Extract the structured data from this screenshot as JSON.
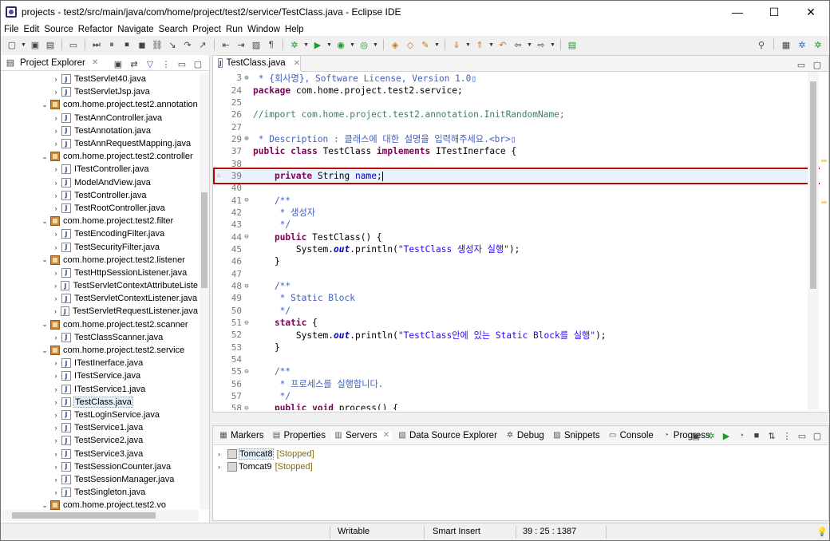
{
  "window": {
    "title": "projects - test2/src/main/java/com/home/project/test2/service/TestClass.java - Eclipse IDE",
    "minimize": "—",
    "maximize": "☐",
    "close": "✕"
  },
  "menu": [
    "File",
    "Edit",
    "Source",
    "Refactor",
    "Navigate",
    "Search",
    "Project",
    "Run",
    "Window",
    "Help"
  ],
  "project_explorer": {
    "title": "Project Explorer",
    "items": [
      {
        "label": "TestServlet40.java",
        "type": "java",
        "indent": 2,
        "twisty": "›"
      },
      {
        "label": "TestServletJsp.java",
        "type": "java",
        "indent": 2,
        "twisty": "›"
      },
      {
        "label": "com.home.project.test2.annotation",
        "type": "pkg",
        "indent": 1,
        "twisty": "⌄"
      },
      {
        "label": "TestAnnController.java",
        "type": "java",
        "indent": 2,
        "twisty": "›"
      },
      {
        "label": "TestAnnotation.java",
        "type": "java",
        "indent": 2,
        "twisty": "›"
      },
      {
        "label": "TestAnnRequestMapping.java",
        "type": "java",
        "indent": 2,
        "twisty": "›"
      },
      {
        "label": "com.home.project.test2.controller",
        "type": "pkg",
        "indent": 1,
        "twisty": "⌄"
      },
      {
        "label": "ITestController.java",
        "type": "java",
        "indent": 2,
        "twisty": "›"
      },
      {
        "label": "ModelAndView.java",
        "type": "java",
        "indent": 2,
        "twisty": "›"
      },
      {
        "label": "TestController.java",
        "type": "java",
        "indent": 2,
        "twisty": "›"
      },
      {
        "label": "TestRootController.java",
        "type": "java",
        "indent": 2,
        "twisty": "›"
      },
      {
        "label": "com.home.project.test2.filter",
        "type": "pkg",
        "indent": 1,
        "twisty": "⌄"
      },
      {
        "label": "TestEncodingFilter.java",
        "type": "java",
        "indent": 2,
        "twisty": "›"
      },
      {
        "label": "TestSecurityFilter.java",
        "type": "java",
        "indent": 2,
        "twisty": "›"
      },
      {
        "label": "com.home.project.test2.listener",
        "type": "pkg",
        "indent": 1,
        "twisty": "⌄"
      },
      {
        "label": "TestHttpSessionListener.java",
        "type": "java",
        "indent": 2,
        "twisty": "›"
      },
      {
        "label": "TestServletContextAttributeListe",
        "type": "java",
        "indent": 2,
        "twisty": "›"
      },
      {
        "label": "TestServletContextListener.java",
        "type": "java",
        "indent": 2,
        "twisty": "›"
      },
      {
        "label": "TestServletRequestListener.java",
        "type": "java",
        "indent": 2,
        "twisty": "›"
      },
      {
        "label": "com.home.project.test2.scanner",
        "type": "pkg",
        "indent": 1,
        "twisty": "⌄"
      },
      {
        "label": "TestClassScanner.java",
        "type": "java",
        "indent": 2,
        "twisty": "›"
      },
      {
        "label": "com.home.project.test2.service",
        "type": "pkg",
        "indent": 1,
        "twisty": "⌄"
      },
      {
        "label": "ITestInerface.java",
        "type": "java",
        "indent": 2,
        "twisty": "›"
      },
      {
        "label": "ITestService.java",
        "type": "java",
        "indent": 2,
        "twisty": "›"
      },
      {
        "label": "ITestService1.java",
        "type": "java",
        "indent": 2,
        "twisty": "›"
      },
      {
        "label": "TestClass.java",
        "type": "java",
        "indent": 2,
        "twisty": "›",
        "selected": true
      },
      {
        "label": "TestLoginService.java",
        "type": "java",
        "indent": 2,
        "twisty": "›"
      },
      {
        "label": "TestService1.java",
        "type": "java",
        "indent": 2,
        "twisty": "›"
      },
      {
        "label": "TestService2.java",
        "type": "java",
        "indent": 2,
        "twisty": "›"
      },
      {
        "label": "TestService3.java",
        "type": "java",
        "indent": 2,
        "twisty": "›"
      },
      {
        "label": "TestSessionCounter.java",
        "type": "java",
        "indent": 2,
        "twisty": "›"
      },
      {
        "label": "TestSessionManager.java",
        "type": "java",
        "indent": 2,
        "twisty": "›"
      },
      {
        "label": "TestSingleton.java",
        "type": "java",
        "indent": 2,
        "twisty": "›"
      },
      {
        "label": "com.home.project.test2.vo",
        "type": "pkg",
        "indent": 1,
        "twisty": "⌄"
      }
    ]
  },
  "editor": {
    "tab_label": "TestClass.java",
    "lines": [
      {
        "n": "3",
        "fold": "⊕",
        "parts": [
          [
            "cm",
            " * {회사명}, Software License, Version 1.0▯"
          ]
        ]
      },
      {
        "n": "24",
        "fold": "",
        "parts": [
          [
            "kw",
            "package"
          ],
          [
            "",
            " com.home.project.test2.service;"
          ]
        ]
      },
      {
        "n": "25",
        "fold": "",
        "parts": [
          [
            "",
            ""
          ]
        ]
      },
      {
        "n": "26",
        "fold": "",
        "parts": [
          [
            "cm2",
            "//import com.home.project.test2.annotation.InitRandomName;"
          ]
        ]
      },
      {
        "n": "27",
        "fold": "",
        "parts": [
          [
            "",
            ""
          ]
        ]
      },
      {
        "n": "29",
        "fold": "⊕",
        "parts": [
          [
            "cm",
            " * Description : 클래스에 대한 설명을 입력해주세요.<br>▯"
          ]
        ]
      },
      {
        "n": "37",
        "fold": "",
        "parts": [
          [
            "kw",
            "public class"
          ],
          [
            "",
            " TestClass "
          ],
          [
            "kw",
            "implements"
          ],
          [
            "",
            " ITestInerface {"
          ]
        ]
      },
      {
        "n": "38",
        "fold": "",
        "parts": [
          [
            "",
            ""
          ]
        ]
      },
      {
        "n": "39",
        "fold": "",
        "marker": "warn",
        "current": true,
        "parts": [
          [
            "",
            "    "
          ],
          [
            "kw",
            "private"
          ],
          [
            "",
            " String "
          ],
          [
            "fld",
            "name"
          ],
          [
            "",
            ";"
          ]
        ]
      },
      {
        "n": "40",
        "fold": "",
        "parts": [
          [
            "",
            ""
          ]
        ]
      },
      {
        "n": "41",
        "fold": "⊖",
        "parts": [
          [
            "cm",
            "    /**"
          ]
        ]
      },
      {
        "n": "42",
        "fold": "",
        "parts": [
          [
            "cm",
            "     * 생성자"
          ]
        ]
      },
      {
        "n": "43",
        "fold": "",
        "parts": [
          [
            "cm",
            "     */"
          ]
        ]
      },
      {
        "n": "44",
        "fold": "⊖",
        "parts": [
          [
            "",
            "    "
          ],
          [
            "kw",
            "public"
          ],
          [
            "",
            " TestClass() {"
          ]
        ]
      },
      {
        "n": "45",
        "fold": "",
        "parts": [
          [
            "",
            "        System."
          ],
          [
            "itl",
            "out"
          ],
          [
            "",
            ".println("
          ],
          [
            "str",
            "\"TestClass 생성자 실행\""
          ],
          [
            "",
            ");"
          ]
        ]
      },
      {
        "n": "46",
        "fold": "",
        "parts": [
          [
            "",
            "    }"
          ]
        ]
      },
      {
        "n": "47",
        "fold": "",
        "parts": [
          [
            "",
            ""
          ]
        ]
      },
      {
        "n": "48",
        "fold": "⊖",
        "parts": [
          [
            "cm",
            "    /**"
          ]
        ]
      },
      {
        "n": "49",
        "fold": "",
        "parts": [
          [
            "cm",
            "     * Static Block"
          ]
        ]
      },
      {
        "n": "50",
        "fold": "",
        "parts": [
          [
            "cm",
            "     */"
          ]
        ]
      },
      {
        "n": "51",
        "fold": "⊖",
        "parts": [
          [
            "",
            "    "
          ],
          [
            "kw",
            "static"
          ],
          [
            "",
            " {"
          ]
        ]
      },
      {
        "n": "52",
        "fold": "",
        "parts": [
          [
            "",
            "        System."
          ],
          [
            "itl",
            "out"
          ],
          [
            "",
            ".println("
          ],
          [
            "str",
            "\"TestClass안에 있는 Static Block를 실행\""
          ],
          [
            "",
            ");"
          ]
        ]
      },
      {
        "n": "53",
        "fold": "",
        "parts": [
          [
            "",
            "    }"
          ]
        ]
      },
      {
        "n": "54",
        "fold": "",
        "parts": [
          [
            "",
            ""
          ]
        ]
      },
      {
        "n": "55",
        "fold": "⊖",
        "parts": [
          [
            "cm",
            "    /**"
          ]
        ]
      },
      {
        "n": "56",
        "fold": "",
        "parts": [
          [
            "cm",
            "     * 프로세스를 실행합니다."
          ]
        ]
      },
      {
        "n": "57",
        "fold": "",
        "parts": [
          [
            "cm",
            "     */"
          ]
        ]
      },
      {
        "n": "58",
        "fold": "⊖",
        "parts": [
          [
            "",
            "    "
          ],
          [
            "kw",
            "public void"
          ],
          [
            "",
            " process() {"
          ]
        ]
      }
    ]
  },
  "bottom_panel": {
    "tabs": [
      {
        "label": "Markers",
        "icon": "markers-icon",
        "glyph": "▦"
      },
      {
        "label": "Properties",
        "icon": "properties-icon",
        "glyph": "▤"
      },
      {
        "label": "Servers",
        "icon": "servers-icon",
        "glyph": "▥",
        "active": true,
        "close": "✕"
      },
      {
        "label": "Data Source Explorer",
        "icon": "datasource-icon",
        "glyph": "▧"
      },
      {
        "label": "Debug",
        "icon": "debug-icon",
        "glyph": "✲"
      },
      {
        "label": "Snippets",
        "icon": "snippets-icon",
        "glyph": "▨"
      },
      {
        "label": "Console",
        "icon": "console-icon",
        "glyph": "▭"
      },
      {
        "label": "Progress",
        "icon": "progress-icon",
        "glyph": "◔"
      }
    ],
    "servers": [
      {
        "name": "Tomcat8",
        "state": "[Stopped]",
        "selected": true
      },
      {
        "name": "Tomcat9",
        "state": "[Stopped]",
        "selected": false
      }
    ]
  },
  "status": {
    "mode": "Writable",
    "insert": "Smart Insert",
    "position": "39 : 25 : 1387"
  }
}
